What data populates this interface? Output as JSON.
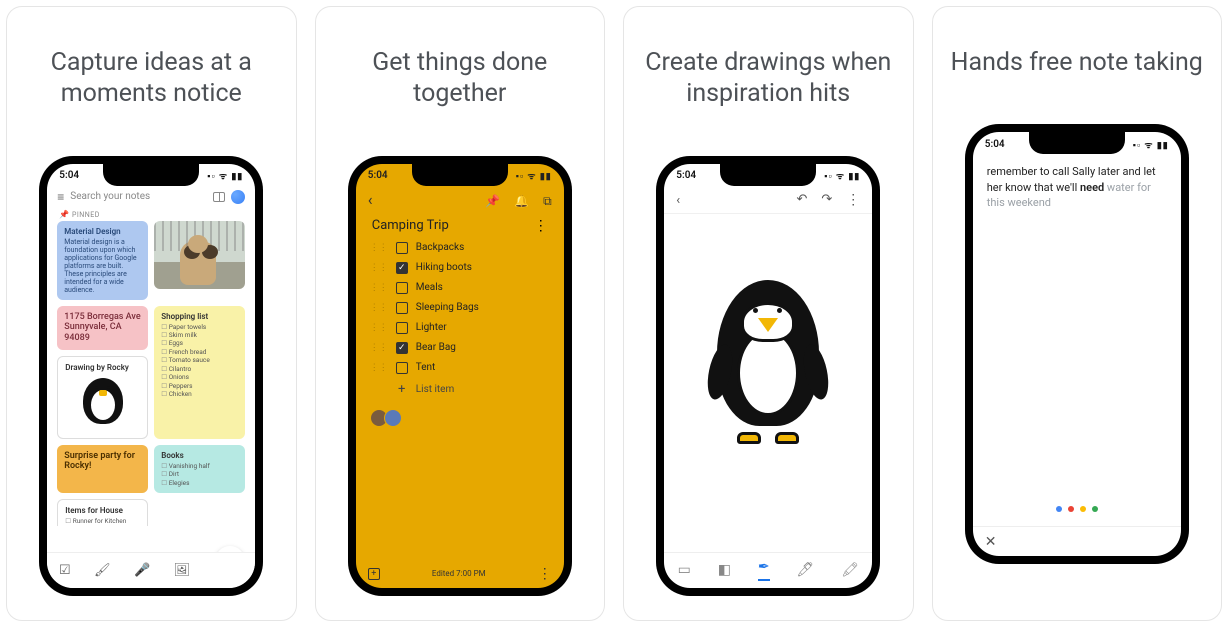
{
  "captions": [
    "Capture ideas at a moments notice",
    "Get things done together",
    "Create drawings when inspiration hits",
    "Hands free note taking"
  ],
  "status_time": "5:04",
  "status_icons": "▪▫ ᯤ ▮▮",
  "phone1": {
    "search_placeholder": "Search your notes",
    "pinned_label": "PINNED",
    "material": {
      "title": "Material Design",
      "body": "Material design is a foundation upon which applications for Google platforms are built. These principles are intended for a wide audience."
    },
    "address": "1175 Borregas Ave Sunnyvale, CA 94089",
    "shopping": {
      "title": "Shopping list",
      "items": [
        "Paper towels",
        "Skim milk",
        "Eggs",
        "French bread",
        "Tomato sauce",
        "Cilantro",
        "Onions",
        "Peppers",
        "Chicken"
      ]
    },
    "drawing_title": "Drawing by Rocky",
    "surprise": "Surprise party for Rocky!",
    "books": {
      "title": "Books",
      "items": [
        "Vanishing half",
        "Dirt",
        "Elegies"
      ]
    },
    "house": {
      "title": "Items for House",
      "items": [
        "Runner for Kitchen"
      ]
    }
  },
  "phone2": {
    "title": "Camping Trip",
    "items": [
      {
        "label": "Backpacks",
        "checked": false
      },
      {
        "label": "Hiking boots",
        "checked": true
      },
      {
        "label": "Meals",
        "checked": false
      },
      {
        "label": "Sleeping Bags",
        "checked": false
      },
      {
        "label": "Lighter",
        "checked": false
      },
      {
        "label": "Bear Bag",
        "checked": true
      },
      {
        "label": "Tent",
        "checked": false
      }
    ],
    "add_item": "List item",
    "edited": "Edited 7:00 PM"
  },
  "phone4": {
    "typed": "remember to call Sally later and let her know that we'll need",
    "ghost": " water for this weekend"
  }
}
